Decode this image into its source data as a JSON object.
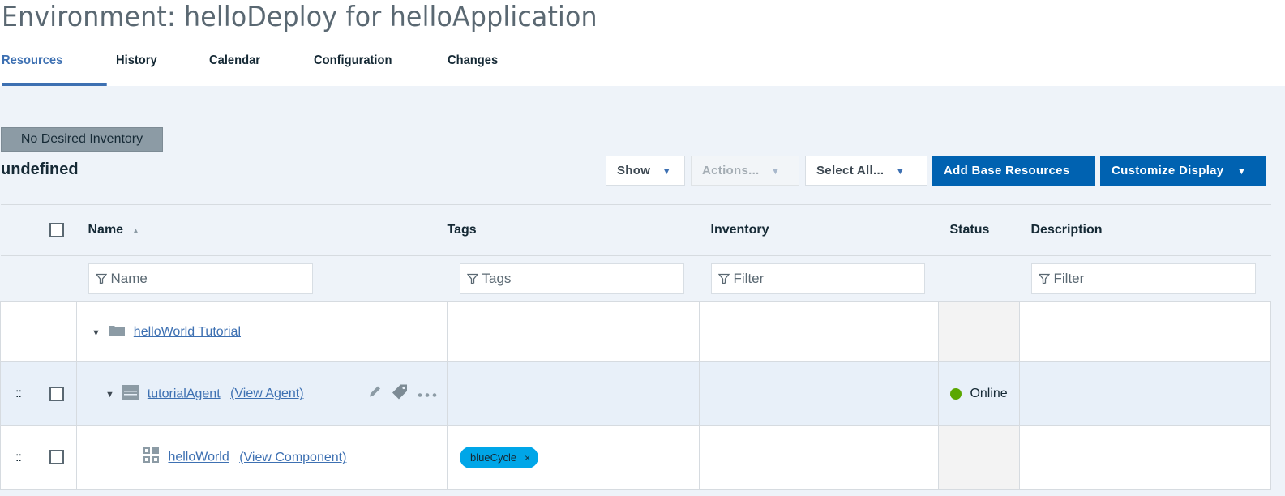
{
  "page": {
    "title": "Environment: helloDeploy for helloApplication"
  },
  "tabs": [
    {
      "label": "Resources",
      "active": true
    },
    {
      "label": "History",
      "active": false
    },
    {
      "label": "Calendar",
      "active": false
    },
    {
      "label": "Configuration",
      "active": false
    },
    {
      "label": "Changes",
      "active": false
    }
  ],
  "inventory_badge": "No Desired Inventory",
  "section_title": "undefined",
  "toolbar": {
    "show_label": "Show",
    "actions_label": "Actions...",
    "select_all_label": "Select All...",
    "add_base_label": "Add Base Resources",
    "customize_label": "Customize Display",
    "caret": "▼"
  },
  "table": {
    "columns": {
      "name": "Name",
      "name_sort": "▲",
      "tags": "Tags",
      "inventory": "Inventory",
      "status": "Status",
      "description": "Description"
    },
    "filters": {
      "name_placeholder": "Name",
      "tags_placeholder": "Tags",
      "inventory_placeholder": "Filter",
      "description_placeholder": "Filter"
    },
    "rows": [
      {
        "name": "helloWorld Tutorial",
        "type": "folder",
        "expanded": true
      },
      {
        "name": "tutorialAgent",
        "view_link": "(View Agent)",
        "type": "agent",
        "expanded": true,
        "status": "Online",
        "status_color": "#5aa700",
        "drag_handle": "::"
      },
      {
        "name": "helloWorld",
        "view_link": "(View Component)",
        "type": "component",
        "tag": "blueCycle",
        "tag_remove": "×",
        "tag_color": "#00a6e8",
        "drag_handle": "::"
      }
    ]
  },
  "colors": {
    "accent": "#3d70b2",
    "primary_button": "#0062b1",
    "background": "#eef3f9"
  }
}
